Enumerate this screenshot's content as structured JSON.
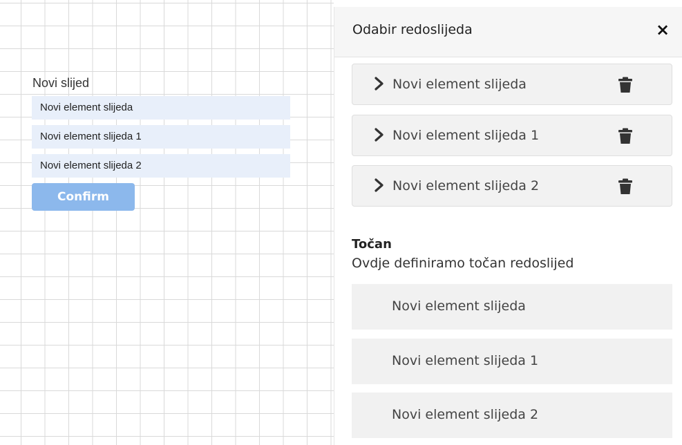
{
  "question": {
    "title": "Novi slijed",
    "items": [
      "Novi element slijeda",
      "Novi element slijeda 1",
      "Novi element slijeda 2"
    ],
    "confirm_label": "Confirm"
  },
  "panel": {
    "title": "Odabir redoslijeda",
    "close_symbol": "×",
    "sequence_items": [
      {
        "label": "Novi element slijeda",
        "expand_icon": "chevron-right-icon",
        "delete_icon": "trash-icon"
      },
      {
        "label": "Novi element slijeda 1",
        "expand_icon": "chevron-right-icon",
        "delete_icon": "trash-icon"
      },
      {
        "label": "Novi element slijeda 2",
        "expand_icon": "chevron-right-icon",
        "delete_icon": "trash-icon"
      }
    ],
    "correct": {
      "title": "Točan",
      "description": "Ovdje definiramo točan redoslijed",
      "items": [
        "Novi element slijeda",
        "Novi element slijeda 1",
        "Novi element slijeda 2"
      ]
    }
  },
  "colors": {
    "confirm_button": "#8cb8ec",
    "question_item_bg": "#e8effa",
    "panel_item_bg": "#f2f2f2",
    "grid_line": "#d9d9d9"
  }
}
